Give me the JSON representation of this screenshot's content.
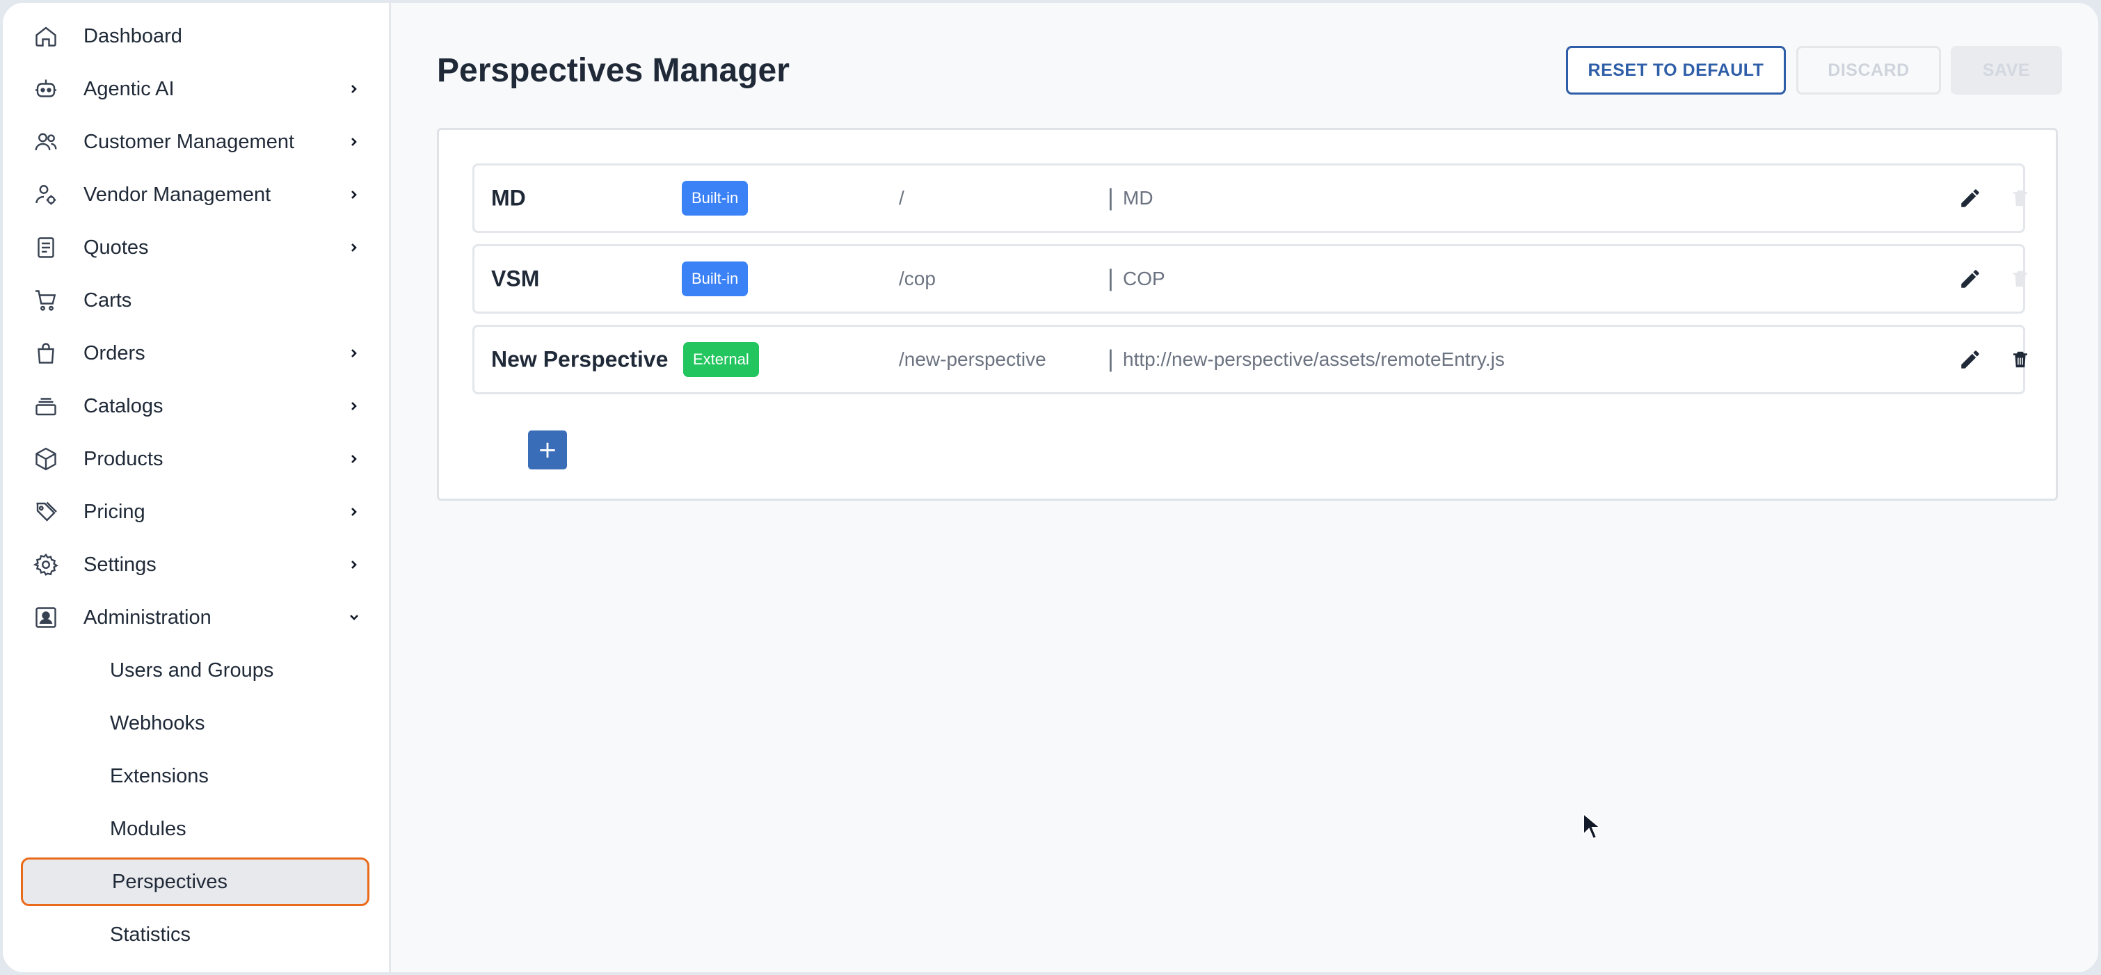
{
  "sidebar": {
    "items": [
      {
        "label": "Dashboard",
        "icon": "home-icon",
        "expandable": false
      },
      {
        "label": "Agentic AI",
        "icon": "robot-icon",
        "expandable": true
      },
      {
        "label": "Customer Management",
        "icon": "users-icon",
        "expandable": true
      },
      {
        "label": "Vendor Management",
        "icon": "user-cog-icon",
        "expandable": true
      },
      {
        "label": "Quotes",
        "icon": "document-icon",
        "expandable": true
      },
      {
        "label": "Carts",
        "icon": "cart-icon",
        "expandable": false
      },
      {
        "label": "Orders",
        "icon": "bag-icon",
        "expandable": true
      },
      {
        "label": "Catalogs",
        "icon": "stack-icon",
        "expandable": true
      },
      {
        "label": "Products",
        "icon": "box-icon",
        "expandable": true
      },
      {
        "label": "Pricing",
        "icon": "tags-icon",
        "expandable": true
      },
      {
        "label": "Settings",
        "icon": "gear-icon",
        "expandable": true
      },
      {
        "label": "Administration",
        "icon": "id-card-icon",
        "expandable": true,
        "expanded": true
      }
    ],
    "admin_children": [
      {
        "label": "Users and Groups"
      },
      {
        "label": "Webhooks"
      },
      {
        "label": "Extensions"
      },
      {
        "label": "Modules"
      },
      {
        "label": "Perspectives",
        "active": true
      },
      {
        "label": "Statistics"
      }
    ]
  },
  "header": {
    "title": "Perspectives Manager",
    "reset_label": "RESET TO DEFAULT",
    "discard_label": "DISCARD",
    "save_label": "SAVE"
  },
  "perspectives": [
    {
      "name": "MD",
      "badge": "Built-in",
      "path": "/",
      "separator": "|",
      "target": "MD",
      "deletable": false
    },
    {
      "name": "VSM",
      "badge": "Built-in",
      "path": "/cop",
      "separator": "|",
      "target": "COP",
      "deletable": false
    },
    {
      "name": "New Perspective",
      "badge": "External",
      "path": "/new-perspective",
      "separator": "|",
      "target": "http://new-perspective/assets/remoteEntry.js",
      "deletable": true
    }
  ],
  "add_label": "+",
  "colors": {
    "accent": "#2f5ea8",
    "active_border": "#ea6a1a",
    "builtin_badge": "#3b82f6",
    "external_badge": "#22c55e",
    "add_button": "#3a6db7"
  }
}
